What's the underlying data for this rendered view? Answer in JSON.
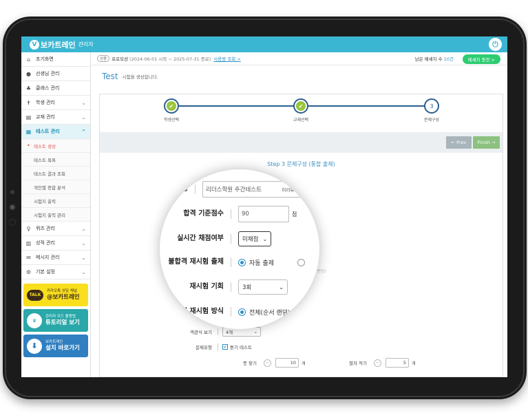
{
  "header": {
    "logo_mark": "V",
    "brand": "보카트레인",
    "brand_sub": "관리자",
    "power_icon": "power-icon"
  },
  "sidebar": {
    "items": [
      {
        "icon": "⌂",
        "label": "초기화면"
      },
      {
        "icon": "●",
        "label": "선생님 관리"
      },
      {
        "icon": "♣",
        "label": "클래스 관리"
      },
      {
        "icon": "✝",
        "label": "학생 관리",
        "chevron": "⌄"
      },
      {
        "icon": "▤",
        "label": "교재 관리",
        "chevron": "⌄"
      },
      {
        "icon": "▦",
        "label": "테스트 관리",
        "chevron": "⌃"
      }
    ],
    "sub_items": [
      "테스트 생성",
      "테스트 목록",
      "테스트 결과 조회",
      "개인별 종합 분석",
      "시험지 출력",
      "시험지 출력 관리"
    ],
    "items2": [
      {
        "icon": "♀",
        "label": "퀴즈 관리",
        "chevron": "⌄"
      },
      {
        "icon": "▥",
        "label": "성적 관리",
        "chevron": "⌄"
      },
      {
        "icon": "✉",
        "label": "메시지 관리",
        "chevron": "⌄"
      },
      {
        "icon": "⚙",
        "label": "기본 설정",
        "chevron": "⌄"
      }
    ],
    "banners": {
      "kakao": {
        "icon": "TALK",
        "small": "카카오톡 상담 채널",
        "big": "@보카트레인"
      },
      "tutorial": {
        "icon": "♛",
        "small": "관리자 모드 활용법",
        "big": "튜토리얼 보기"
      },
      "install": {
        "icon": "⬇",
        "small": "보카트레인",
        "big": "설치 바로가기"
      }
    }
  },
  "infobar": {
    "badge": "상용",
    "program": "프로모션",
    "period": "(2024-06-01 시작 ~ 2025-07-31 종료)",
    "view_link": "사용량 조회 >",
    "msg_prefix": "남은 메세지 수",
    "msg_count": "10건",
    "charge_button": "메세지 충전 >"
  },
  "title": {
    "main": "Test",
    "desc": "시험을 생성합니다."
  },
  "steps": [
    {
      "label": "학생선택",
      "done": true,
      "mark": "✔"
    },
    {
      "label": "교재선택",
      "done": true,
      "mark": "✔"
    },
    {
      "label": "문제구성",
      "done": false,
      "mark": "3"
    }
  ],
  "actions": {
    "prev": "← Prev",
    "finish": "Finish →"
  },
  "form": {
    "title": "Step 3 문제구성 (통합 출제)",
    "test_name": {
      "label": "시험명",
      "value": "리더스학원 주간테스트",
      "preview": "미리보기 >"
    },
    "pass_score": {
      "label": "합격 기준점수",
      "value": "90",
      "unit": "점"
    },
    "realtime": {
      "label": "실시간 채점여부",
      "value": "미채점"
    },
    "retest": {
      "label": "불합격 재시험 출제",
      "option1": "자동 출제",
      "faint_hint": "(순서 랜덤)"
    },
    "retest_chance": {
      "label": "재시험 기회",
      "value": "3회"
    },
    "retest_method": {
      "label": "합격 재시험 방식",
      "option1": "전체(순서 랜덤)"
    },
    "objective": {
      "label": "객관식 보기",
      "value": "4개"
    },
    "question_type": {
      "label": "문제유형",
      "checkbox_label": "듣기 테스트"
    },
    "counts": [
      {
        "label": "뜻 찾기",
        "value": "10",
        "unit": "개"
      },
      {
        "label": "철자 적기",
        "value": "5",
        "unit": "개"
      }
    ]
  }
}
